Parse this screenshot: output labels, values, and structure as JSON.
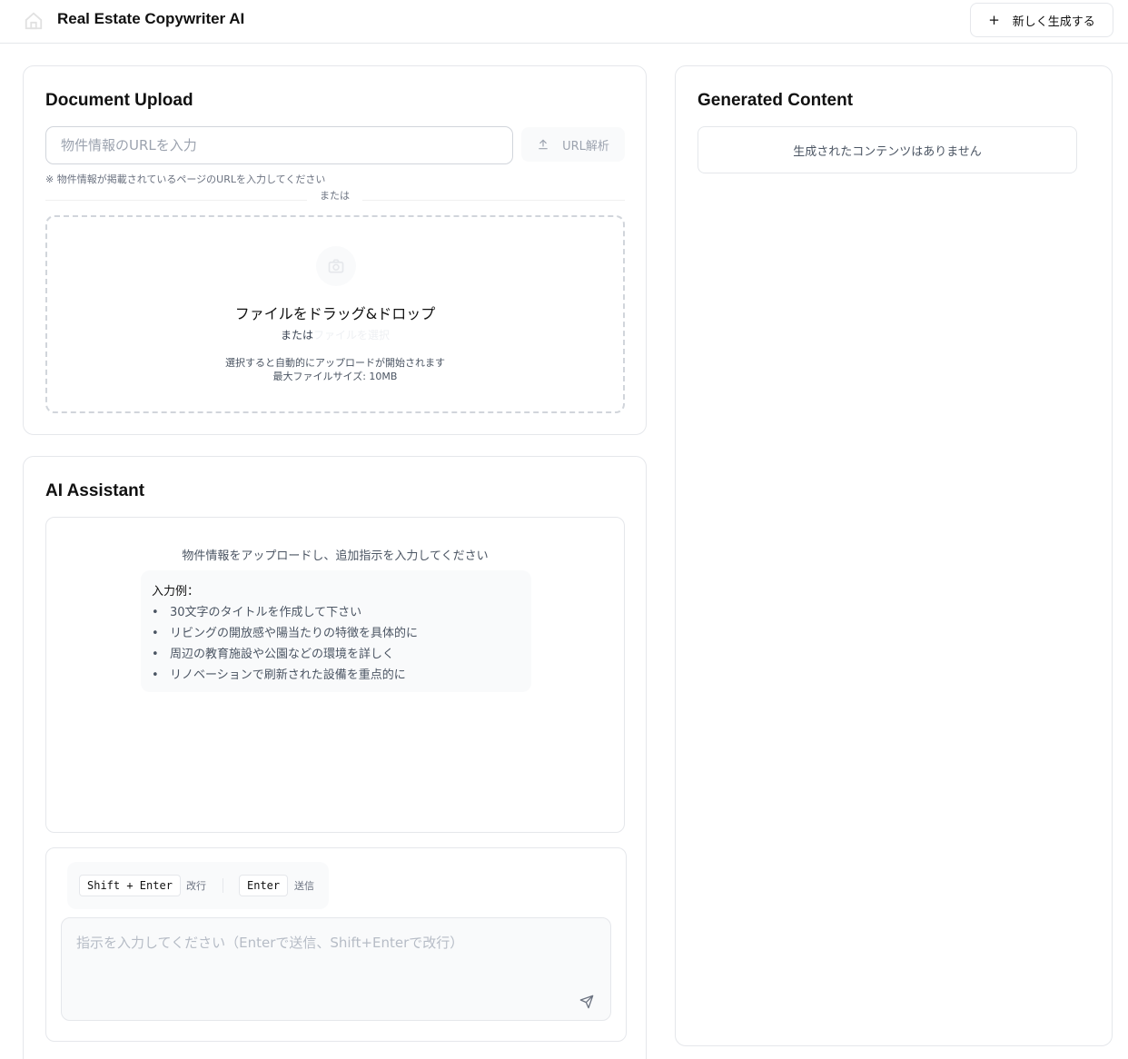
{
  "header": {
    "app_title": "Real Estate Copywriter AI",
    "new_button_icon": "plus-icon",
    "new_button_label": "新しく生成する"
  },
  "upload": {
    "title": "Document Upload",
    "url_placeholder": "物件情報のURLを入力",
    "url_value": "",
    "url_button_label": "URL解析",
    "url_button_icon": "upload-icon",
    "hint": "※ 物件情報が掲載されているページのURLを入力してください",
    "or_divider": "または",
    "dropzone": {
      "icon": "camera-icon",
      "title": "ファイルをドラッグ&ドロップ",
      "or": "または",
      "select_link": "ファイルを選択",
      "note_line1": "選択すると自動的にアップロードが開始されます",
      "note_line2": "最大ファイルサイズ: 10MB"
    }
  },
  "assistant": {
    "title": "AI Assistant",
    "intro": "物件情報をアップロードし、追加指示を入力してください",
    "examples_title": "入力例：",
    "examples": [
      "30文字のタイトルを作成して下さい",
      "リビングの開放感や陽当たりの特徴を具体的に",
      "周辺の教育施設や公園などの環境を詳しく",
      "リノベーションで刷新された設備を重点的に"
    ],
    "shortcuts": {
      "newline_key": "Shift + Enter",
      "newline_label": "改行",
      "send_key": "Enter",
      "send_label": "送信"
    },
    "input_placeholder": "指示を入力してください（Enterで送信、Shift+Enterで改行）",
    "send_icon": "send-icon"
  },
  "generated": {
    "title": "Generated Content",
    "empty_message": "生成されたコンテンツはありません"
  },
  "colors": {
    "border": "#e5e7eb",
    "muted_text": "#6b7280",
    "panel_bg": "#f9fafb"
  }
}
